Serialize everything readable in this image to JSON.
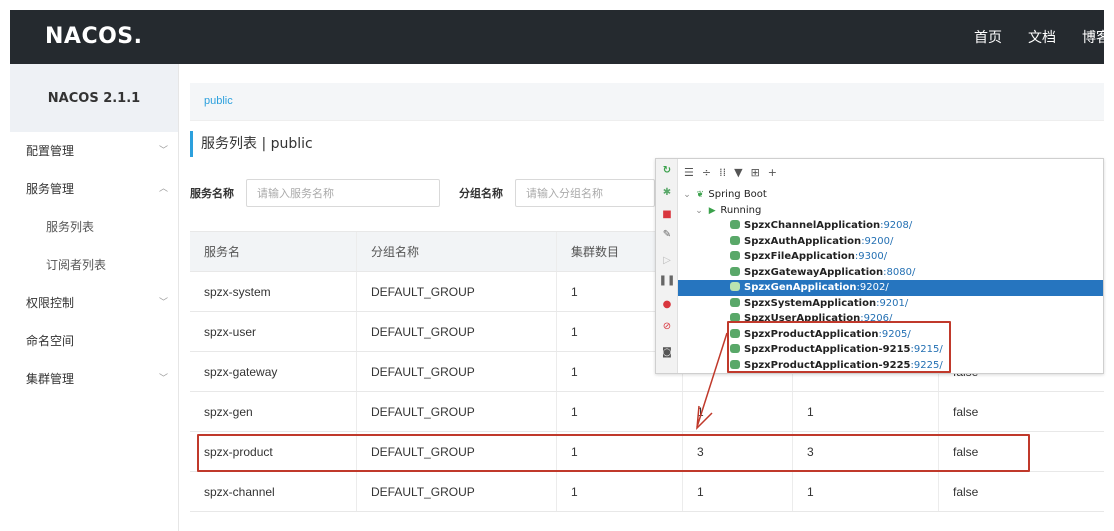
{
  "header": {
    "logo": "NACOS.",
    "nav": [
      "首页",
      "文档",
      "博客"
    ]
  },
  "sidebar": {
    "version": "NACOS 2.1.1",
    "items": [
      {
        "label": "配置管理",
        "arrow": "﹀"
      },
      {
        "label": "服务管理",
        "arrow": "︿"
      },
      {
        "label": "服务列表"
      },
      {
        "label": "订阅者列表"
      },
      {
        "label": "权限控制",
        "arrow": "﹀"
      },
      {
        "label": "命名空间"
      },
      {
        "label": "集群管理",
        "arrow": "﹀"
      }
    ]
  },
  "breadcrumb": "public",
  "page_title": "服务列表 | public",
  "filters": {
    "service_label": "服务名称",
    "service_placeholder": "请输入服务名称",
    "group_label": "分组名称",
    "group_placeholder": "请输入分组名称"
  },
  "table": {
    "headers": [
      "服务名",
      "分组名称",
      "集群数目",
      "",
      "",
      ""
    ],
    "rows": [
      [
        "spzx-system",
        "DEFAULT_GROUP",
        "1",
        "",
        "",
        ""
      ],
      [
        "spzx-user",
        "DEFAULT_GROUP",
        "1",
        "",
        "",
        ""
      ],
      [
        "spzx-gateway",
        "DEFAULT_GROUP",
        "1",
        "",
        "",
        "false"
      ],
      [
        "spzx-gen",
        "DEFAULT_GROUP",
        "1",
        "1",
        "1",
        "false"
      ],
      [
        "spzx-product",
        "DEFAULT_GROUP",
        "1",
        "3",
        "3",
        "false"
      ],
      [
        "spzx-channel",
        "DEFAULT_GROUP",
        "1",
        "1",
        "1",
        "false"
      ]
    ]
  },
  "ide": {
    "toolbar": [
      "☰",
      "÷",
      "⁞⁞",
      "▼",
      "⊞",
      "+"
    ],
    "root": "Spring Boot",
    "group": "Running",
    "apps": [
      {
        "name": "SpzxChannelApplication",
        "port": ":9208/"
      },
      {
        "name": "SpzxAuthApplication",
        "port": ":9200/"
      },
      {
        "name": "SpzxFileApplication",
        "port": ":9300/"
      },
      {
        "name": "SpzxGatewayApplication",
        "port": ":8080/"
      },
      {
        "name": "SpzxGenApplication",
        "port": ":9202/"
      },
      {
        "name": "SpzxSystemApplication",
        "port": ":9201/"
      },
      {
        "name": "SpzxUserApplication",
        "port": ":9206/"
      },
      {
        "name": "SpzxProductApplication",
        "port": ":9205/"
      },
      {
        "name": "SpzxProductApplication-9215",
        "port": ":9215/"
      },
      {
        "name": "SpzxProductApplication-9225",
        "port": ":9225/"
      }
    ]
  },
  "colors": {
    "topbar": "#252a2f",
    "accent": "#2ca0dd",
    "annotation": "#c0392b",
    "selected": "#2675bf"
  }
}
